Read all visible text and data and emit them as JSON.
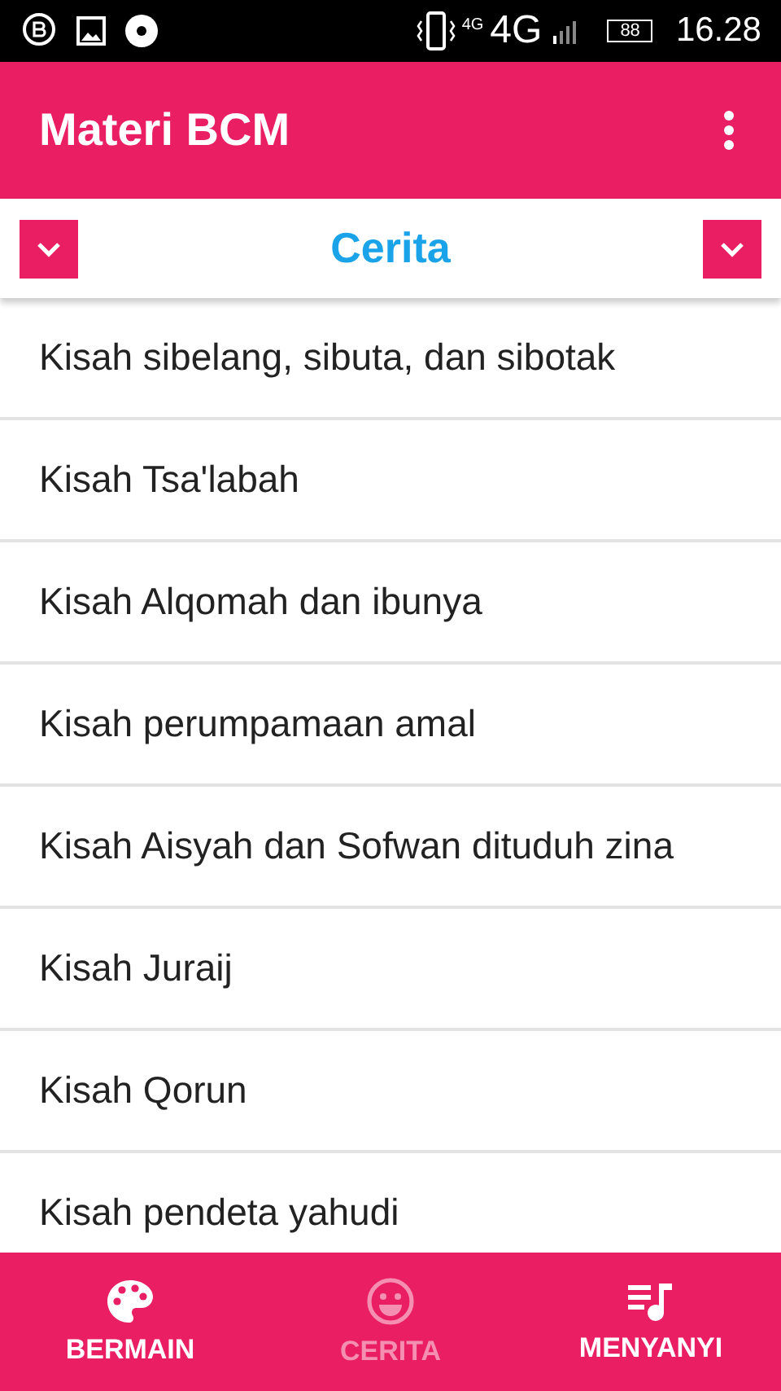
{
  "status_bar": {
    "network_small": "4G",
    "network": "4G",
    "battery": "88",
    "time": "16.28"
  },
  "app_bar": {
    "title": "Materi BCM"
  },
  "header": {
    "title": "Cerita"
  },
  "list": [
    "Kisah sibelang, sibuta, dan sibotak",
    "Kisah Tsa'labah",
    "Kisah Alqomah dan ibunya",
    "Kisah perumpamaan amal",
    "Kisah Aisyah dan Sofwan dituduh zina",
    "Kisah Juraij",
    "Kisah Qorun",
    "Kisah pendeta yahudi"
  ],
  "bottom_nav": [
    {
      "label": "BERMAIN",
      "kind": "palette",
      "selected": false
    },
    {
      "label": "CERITA",
      "kind": "smile",
      "selected": true
    },
    {
      "label": "MENYANYI",
      "kind": "music",
      "selected": false
    }
  ]
}
